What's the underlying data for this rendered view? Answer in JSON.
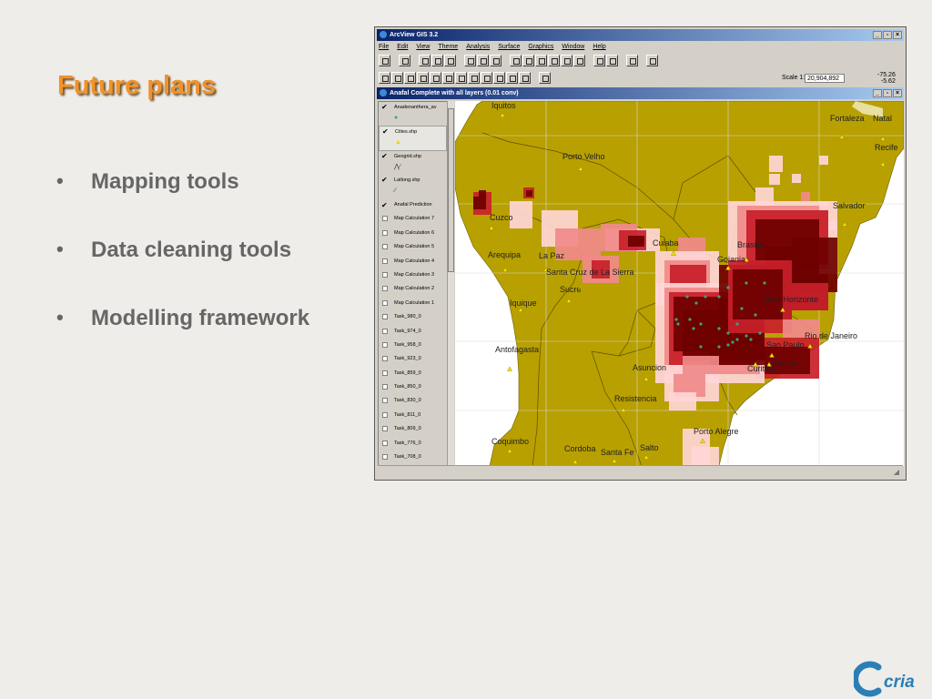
{
  "slide": {
    "title": "Future plans",
    "bullets": [
      "Mapping tools",
      "Data cleaning tools",
      "Modelling framework"
    ],
    "bullet_glyph": "•",
    "logo_text": "cria"
  },
  "app": {
    "title": "ArcView GIS 3.2",
    "menu": [
      "File",
      "Edit",
      "View",
      "Theme",
      "Analysis",
      "Surface",
      "Graphics",
      "Window",
      "Help"
    ],
    "scale_label": "Scale 1:",
    "scale_value": "20,904,892",
    "coord_x": "-75.26",
    "coord_y": "-5.62",
    "view_title": "Anafal Complete with all layers (0.01 conv)",
    "window_buttons": [
      "_",
      "▫",
      "×"
    ]
  },
  "toc": {
    "layers": [
      {
        "name": "Anadenanthera_av",
        "checked": true,
        "legend": "●",
        "legend_color": "#3aa37a"
      },
      {
        "name": "Cities.shp",
        "checked": true,
        "legend": "▲",
        "legend_color": "#e6d800"
      },
      {
        "name": "Geogrid.shp",
        "checked": true,
        "legend": "⋀∕",
        "legend_color": "#333"
      },
      {
        "name": "Latlong.shp",
        "checked": true,
        "legend": "∕∕",
        "legend_color": "#777"
      },
      {
        "name": "Anafal Prediction",
        "checked": true
      },
      {
        "name": "Map Calculation 7",
        "checked": false
      },
      {
        "name": "Map Calculation 6",
        "checked": false
      },
      {
        "name": "Map Calculation 5",
        "checked": false
      },
      {
        "name": "Map Calculation 4",
        "checked": false
      },
      {
        "name": "Map Calculation 3",
        "checked": false
      },
      {
        "name": "Map Calculation 2",
        "checked": false
      },
      {
        "name": "Map Calculation 1",
        "checked": false
      },
      {
        "name": "Task_980_0",
        "checked": false
      },
      {
        "name": "Task_974_0",
        "checked": false
      },
      {
        "name": "Task_958_0",
        "checked": false
      },
      {
        "name": "Task_923_0",
        "checked": false
      },
      {
        "name": "Task_859_0",
        "checked": false
      },
      {
        "name": "Task_850_0",
        "checked": false
      },
      {
        "name": "Task_830_0",
        "checked": false
      },
      {
        "name": "Task_811_0",
        "checked": false
      },
      {
        "name": "Task_809_0",
        "checked": false
      },
      {
        "name": "Task_776_0",
        "checked": false
      },
      {
        "name": "Task_708_0",
        "checked": false
      }
    ]
  },
  "map": {
    "land_color": "#b8a000",
    "ocean_color": "#ffffff",
    "border_color": "#5c5000",
    "prediction_colors": [
      "#ffd6d6",
      "#f08a8a",
      "#c8202a",
      "#6e0000"
    ],
    "occurrence_color": "#3aa37a",
    "city_color": "#f2e600",
    "cities": [
      {
        "name": "Iquitos"
      },
      {
        "name": "Fortaleza"
      },
      {
        "name": "Natal"
      },
      {
        "name": "Recife"
      },
      {
        "name": "Porto Velho"
      },
      {
        "name": "Salvador"
      },
      {
        "name": "Cuzco"
      },
      {
        "name": "Cuiaba"
      },
      {
        "name": "Brasilia"
      },
      {
        "name": "Arequipa"
      },
      {
        "name": "La Paz"
      },
      {
        "name": "Goiania"
      },
      {
        "name": "Santa Cruz de La Sierra"
      },
      {
        "name": "Sucre"
      },
      {
        "name": "Belo Horizonte"
      },
      {
        "name": "Iquique"
      },
      {
        "name": "Rio de Janeiro"
      },
      {
        "name": "Antofagasta"
      },
      {
        "name": "Sao Paulo"
      },
      {
        "name": "Santos"
      },
      {
        "name": "Asuncion"
      },
      {
        "name": "Curitiba"
      },
      {
        "name": "Resistencia"
      },
      {
        "name": "Porto Alegre"
      },
      {
        "name": "Coquimbo"
      },
      {
        "name": "Cordoba"
      },
      {
        "name": "Santa Fe"
      },
      {
        "name": "Salto"
      }
    ]
  }
}
